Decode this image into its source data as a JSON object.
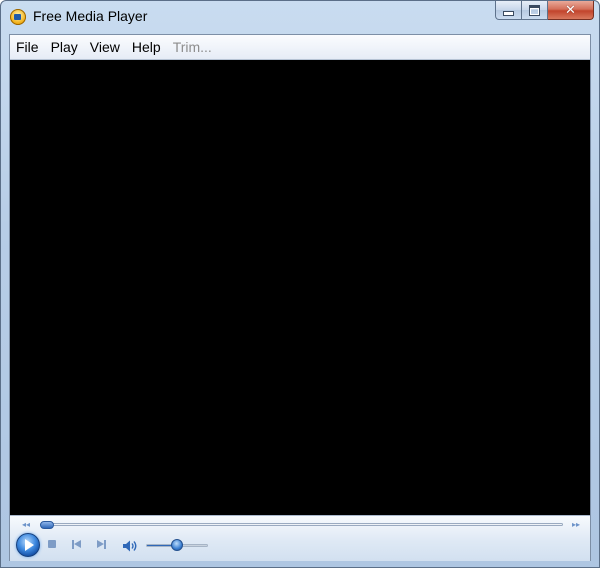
{
  "window": {
    "title": "Free Media Player",
    "icon": "app-media-player-icon"
  },
  "window_controls": {
    "minimize_icon": "minimize-icon",
    "maximize_icon": "maximize-icon",
    "close_glyph": "✕"
  },
  "menu": {
    "items": [
      {
        "label": "File",
        "enabled": true
      },
      {
        "label": "Play",
        "enabled": true
      },
      {
        "label": "View",
        "enabled": true
      },
      {
        "label": "Help",
        "enabled": true
      },
      {
        "label": "Trim...",
        "enabled": false
      }
    ]
  },
  "video": {
    "background_color": "#000000"
  },
  "controls": {
    "seek_back_glyph": "◂◂",
    "seek_forward_glyph": "▸▸",
    "seek_position_fraction": 0.0,
    "volume_fraction": 0.5,
    "accent_color": "#2f68b8",
    "icons": [
      "play-icon",
      "stop-icon",
      "previous-icon",
      "next-icon",
      "speaker-icon"
    ]
  }
}
